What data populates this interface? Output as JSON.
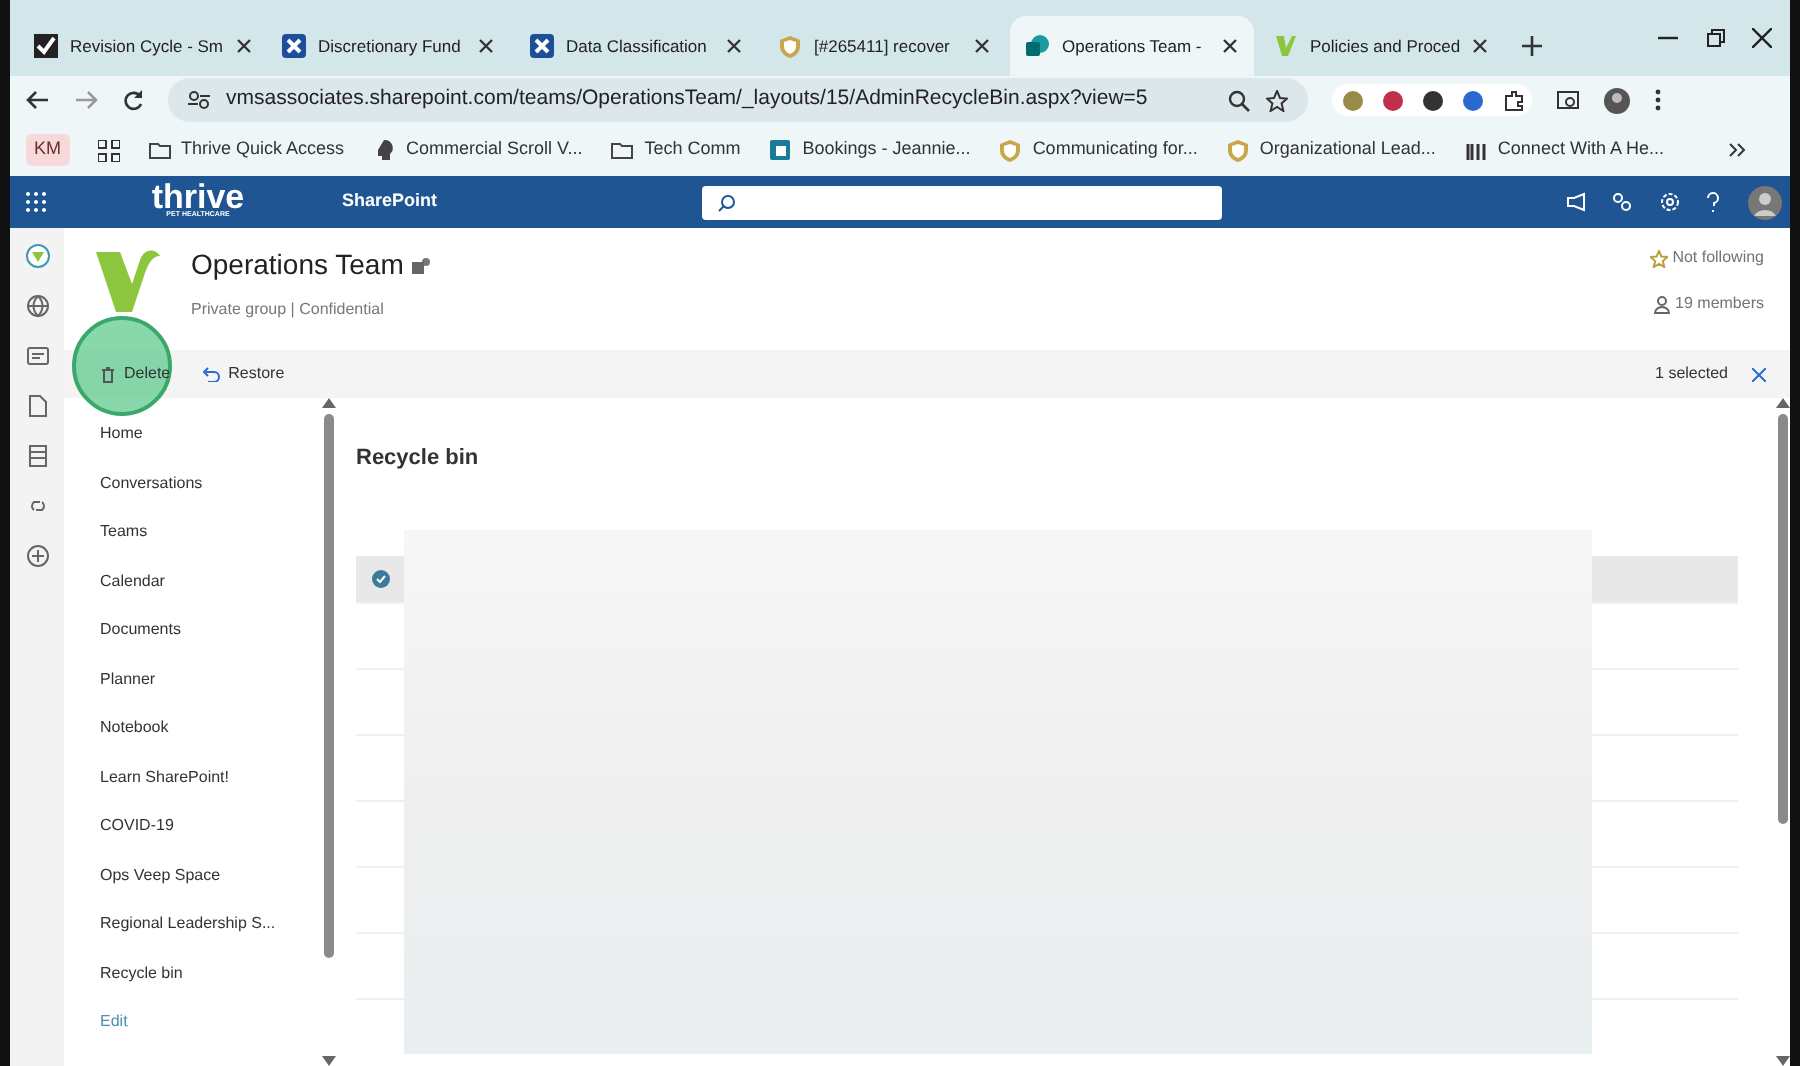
{
  "browser": {
    "tabs": [
      {
        "title": "Revision Cycle - Sm",
        "selected": false
      },
      {
        "title": "Discretionary Fund",
        "selected": false
      },
      {
        "title": "Data Classification",
        "selected": false
      },
      {
        "title": "[#265411] recover",
        "selected": false
      },
      {
        "title": "Operations Team -",
        "selected": true
      },
      {
        "title": "Policies and Proced",
        "selected": false
      }
    ],
    "url": "vmsassociates.sharepoint.com/teams/OperationsTeam/_layouts/15/AdminRecycleBin.aspx?view=5",
    "profile": "KM",
    "bookmarks": [
      "Thrive Quick Access",
      "Commercial Scroll V...",
      "Tech Comm",
      "Bookings - Jeannie...",
      "Communicating for...",
      "Organizational Lead...",
      "Connect With A He..."
    ]
  },
  "suite": {
    "logo": "thrive",
    "logo_sub": "PET HEALTHCARE",
    "app": "SharePoint"
  },
  "site": {
    "title": "Operations Team",
    "subtitle": "Private group | Confidential",
    "follow": "Not following",
    "members": "19 members"
  },
  "commands": {
    "delete": "Delete",
    "restore": "Restore",
    "selection": "1 selected"
  },
  "nav": [
    {
      "label": "Home",
      "kind": "link"
    },
    {
      "label": "Conversations",
      "kind": "link"
    },
    {
      "label": "Teams",
      "kind": "link"
    },
    {
      "label": "Calendar",
      "kind": "link"
    },
    {
      "label": "Documents",
      "kind": "link"
    },
    {
      "label": "Planner",
      "kind": "link"
    },
    {
      "label": "Notebook",
      "kind": "link"
    },
    {
      "label": "Learn SharePoint!",
      "kind": "link"
    },
    {
      "label": "COVID-19",
      "kind": "link"
    },
    {
      "label": "Ops Veep Space",
      "kind": "link"
    },
    {
      "label": "Regional Leadership S...",
      "kind": "link"
    },
    {
      "label": "Recycle bin",
      "kind": "link"
    },
    {
      "label": "Edit",
      "kind": "edit"
    }
  ],
  "content": {
    "title": "Recycle bin",
    "row_selected": true
  }
}
